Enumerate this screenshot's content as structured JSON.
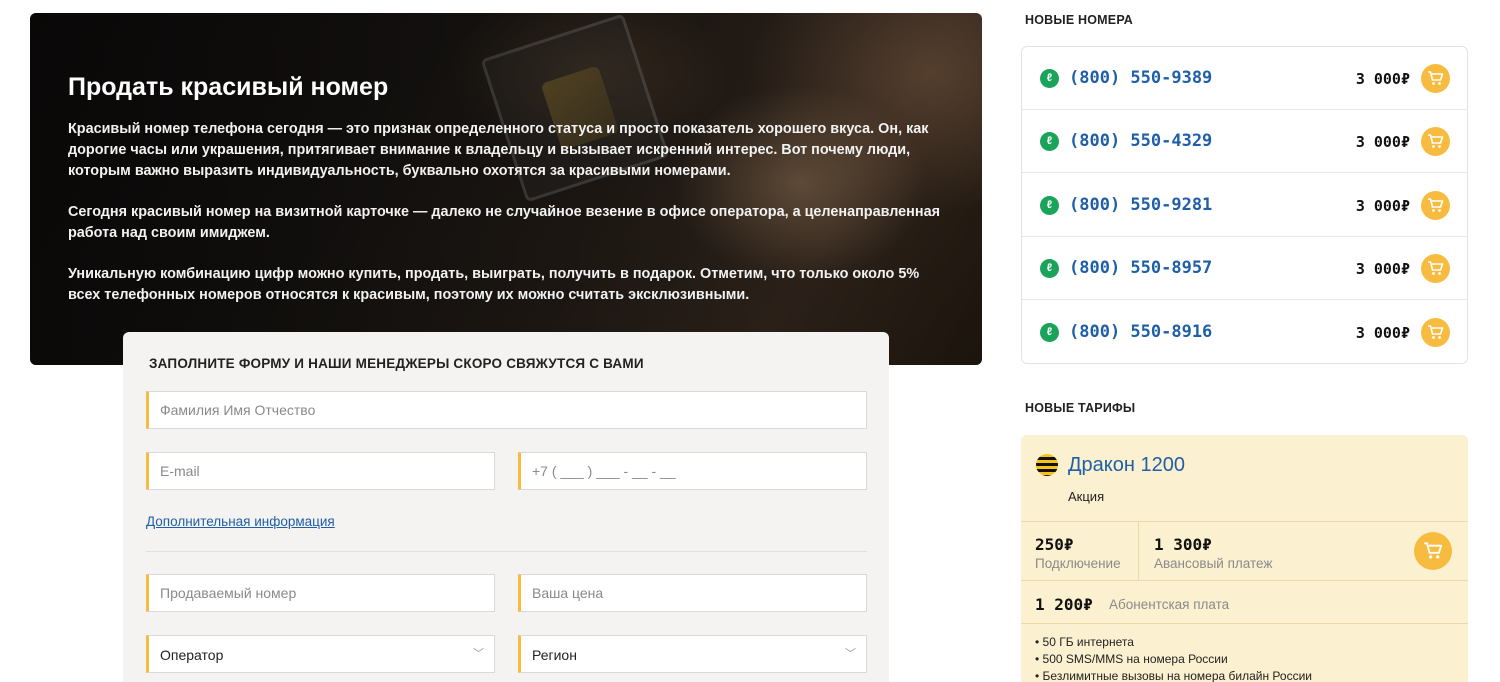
{
  "hero": {
    "title": "Продать красивый номер",
    "paragraphs": [
      "Красивый номер телефона сегодня — это признак определенного статуса и просто показатель хорошего вкуса. Он, как дорогие часы или украшения, притягивает внимание к владельцу и вызывает искренний интерес. Вот почему люди, которым важно выразить индивидуальность, буквально охотятся за красивыми номерами.",
      "Сегодня красивый номер на визитной карточке — далеко не случайное везение в офисе оператора, а целенаправленная работа над своим имиджем.",
      "Уникальную комбинацию цифр можно купить, продать, выиграть, получить в подарок. Отметим, что только около 5% всех телефонных номеров относятся к красивым, поэтому их можно считать эксклюзивными."
    ]
  },
  "form": {
    "title": "ЗАПОЛНИТЕ ФОРМУ И НАШИ МЕНЕДЖЕРЫ СКОРО СВЯЖУТСЯ С ВАМИ",
    "fio_placeholder": "Фамилия Имя Отчество",
    "email_placeholder": "E-mail",
    "phone_placeholder": "+7 ( ___ ) ___ - __ - __",
    "more_link": "Дополнительная информация",
    "number_placeholder": "Продаваемый номер",
    "price_placeholder": "Ваша цена",
    "operator_label": "Оператор",
    "region_label": "Регион"
  },
  "sidebar": {
    "new_numbers_title": "НОВЫЕ НОМЕРА",
    "numbers": [
      {
        "number": "(800) 550-9389",
        "price": "3 000₽"
      },
      {
        "number": "(800) 550-4329",
        "price": "3 000₽"
      },
      {
        "number": "(800) 550-9281",
        "price": "3 000₽"
      },
      {
        "number": "(800) 550-8957",
        "price": "3 000₽"
      },
      {
        "number": "(800) 550-8916",
        "price": "3 000₽"
      }
    ],
    "new_tariffs_title": "НОВЫЕ ТАРИФЫ",
    "tariff": {
      "name": "Дракон 1200",
      "promo": "Акция",
      "connection_value": "250₽",
      "connection_label": "Подключение",
      "advance_value": "1 300₽",
      "advance_label": "Авансовый платеж",
      "monthly_value": "1 200₽",
      "monthly_label": "Абонентская плата",
      "features": [
        "• 50 ГБ интернета",
        "• 500 SMS/MMS на номера России",
        "• Безлимитные вызовы на номера билайн России"
      ]
    }
  },
  "colors": {
    "accent": "#f7bc3f",
    "link": "#1f5fa8",
    "tariff_bg": "#fbf0cf",
    "operator_green": "#1aa35b"
  },
  "icons": {
    "cart": "cart-icon",
    "operator": "operator-logo-icon",
    "chevron": "chevron-down-icon"
  }
}
